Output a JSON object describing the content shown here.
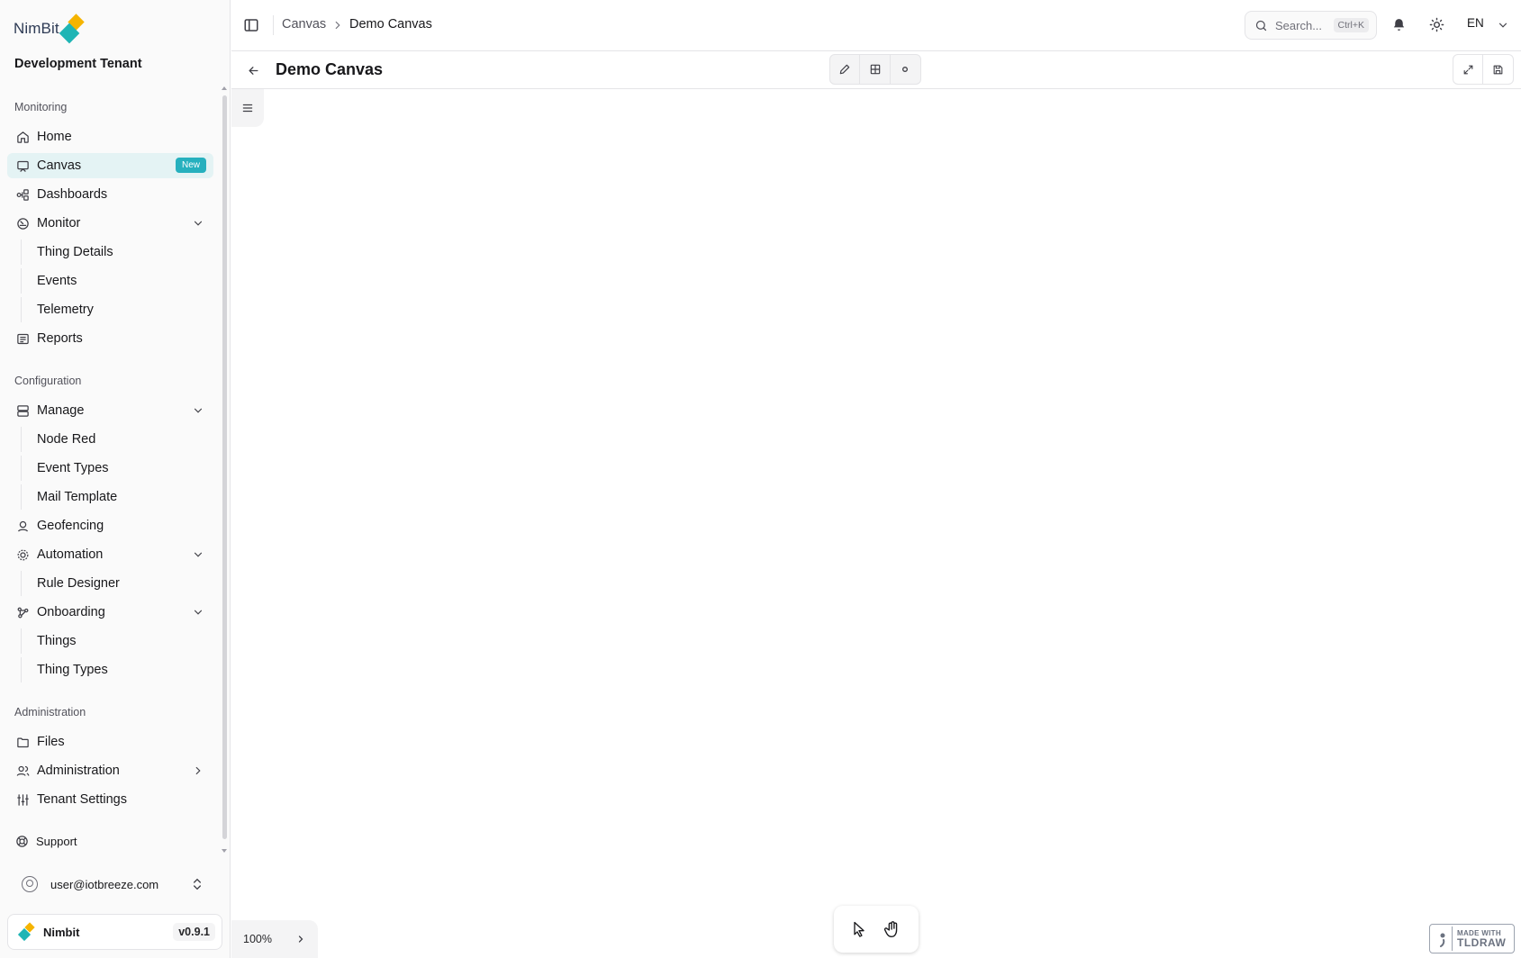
{
  "brand": {
    "logo_text": "NimBit",
    "accent": "#26b0be",
    "gold": "#f5b400",
    "teal": "#1fb5b5"
  },
  "tenant": "Development Tenant",
  "sidebar": {
    "sections": {
      "monitoring": "Monitoring",
      "configuration": "Configuration",
      "administration": "Administration"
    },
    "items": {
      "home": "Home",
      "canvas": "Canvas",
      "canvas_badge": "New",
      "dashboards": "Dashboards",
      "monitor": "Monitor",
      "thing_details": "Thing Details",
      "events": "Events",
      "telemetry": "Telemetry",
      "reports": "Reports",
      "manage": "Manage",
      "node_red": "Node Red",
      "event_types": "Event Types",
      "mail_template": "Mail Template",
      "geofencing": "Geofencing",
      "automation": "Automation",
      "rule_designer": "Rule Designer",
      "onboarding": "Onboarding",
      "things": "Things",
      "thing_types": "Thing Types",
      "files": "Files",
      "administration": "Administration",
      "tenant_settings": "Tenant Settings"
    },
    "support": "Support",
    "user_email": "user@iotbreeze.com",
    "footer": {
      "name": "Nimbit",
      "version": "v0.9.1"
    }
  },
  "topbar": {
    "breadcrumb": [
      "Canvas",
      "Demo Canvas"
    ],
    "search_placeholder": "Search...",
    "search_shortcut": "Ctrl+K",
    "language": "EN"
  },
  "canvas": {
    "title": "Demo Canvas",
    "zoom": "100%",
    "tldraw_small": "MADE WITH",
    "tldraw_big": "TLDRAW"
  }
}
